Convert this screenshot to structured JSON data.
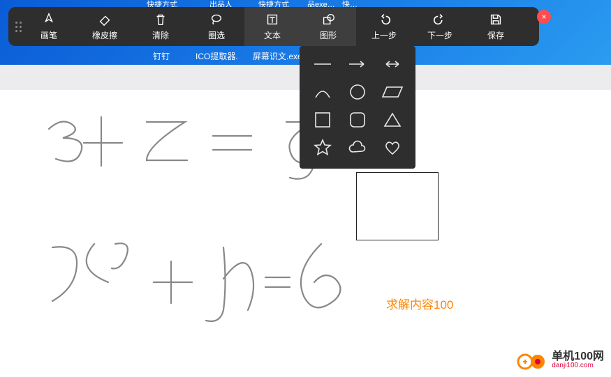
{
  "taskbar_top": {
    "a": "快捷方式",
    "b": "出品人",
    "c": "快捷方式",
    "d": "品exe…",
    "e": "快…"
  },
  "toolbar": {
    "brush": "画笔",
    "eraser": "橡皮擦",
    "clear": "清除",
    "lasso": "圈选",
    "text_tool": "文本",
    "shapes": "图形",
    "undo": "上一步",
    "redo": "下一步",
    "save": "保存",
    "close_glyph": "×"
  },
  "desktop_labels": {
    "dd": "钉钉",
    "ico": "ICO提取器.",
    "screen": "屏幕识文.exe"
  },
  "shape_panel": {
    "names": [
      "line",
      "arrow",
      "double-arrow",
      "arc",
      "circle",
      "parallelogram",
      "square",
      "rounded-square",
      "triangle",
      "star",
      "cloud",
      "heart"
    ]
  },
  "canvas": {
    "orange_text": "求解内容100",
    "handwriting_alt": "3 + 2 = 5  /  x² + y = 6"
  },
  "watermark": {
    "big": "单机100网",
    "small": "danji100.com"
  }
}
